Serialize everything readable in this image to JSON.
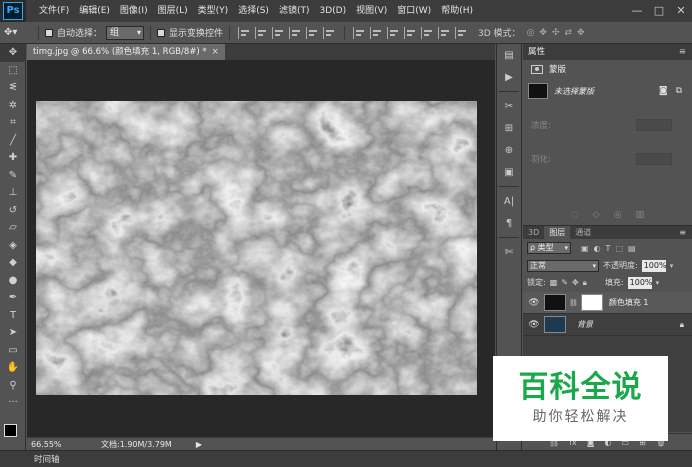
{
  "app": {
    "logo": "Ps"
  },
  "menu": [
    "文件(F)",
    "编辑(E)",
    "图像(I)",
    "图层(L)",
    "类型(Y)",
    "选择(S)",
    "滤镜(T)",
    "3D(D)",
    "视图(V)",
    "窗口(W)",
    "帮助(H)"
  ],
  "window_controls": {
    "minimize": "—",
    "restore": "□",
    "close": "✕"
  },
  "options": {
    "auto_select_label": "自动选择：",
    "auto_select_value": "组",
    "show_transform_label": "显示变换控件",
    "mode_3d_label": "3D 模式："
  },
  "document": {
    "tab_title": "timg.jpg @ 66.6% (颜色填充 1, RGB/8#) *",
    "close": "×"
  },
  "status": {
    "zoom": "66.55%",
    "doc_size": "文档:1.90M/3.79M",
    "arrow": "▶"
  },
  "timeline_label": "时间轴",
  "properties": {
    "title": "属性",
    "menu": "≡",
    "mask_label": "蒙版",
    "layer_name": "未选择蒙版",
    "density_label": "浓度:",
    "feather_label": "羽化:"
  },
  "layers": {
    "tabs": [
      "3D",
      "图层",
      "通道"
    ],
    "menu": "≡",
    "filter_kind": "ρ 类型",
    "blend_mode": "正常",
    "opacity_label": "不透明度:",
    "opacity_value": "100%",
    "lock_label": "锁定:",
    "fill_label": "填充:",
    "fill_value": "100%",
    "items": [
      {
        "name": "颜色填充 1",
        "visible": true,
        "selected": true
      },
      {
        "name": "背景",
        "visible": true,
        "selected": false,
        "locked": true
      }
    ]
  },
  "watermark": {
    "title": "百科全说",
    "subtitle": "助你轻松解决"
  },
  "colors": {
    "menubar": "#3c3c3c",
    "panel": "#535353",
    "canvas_bg": "#282828",
    "watermark_green": "#1aa84b"
  }
}
